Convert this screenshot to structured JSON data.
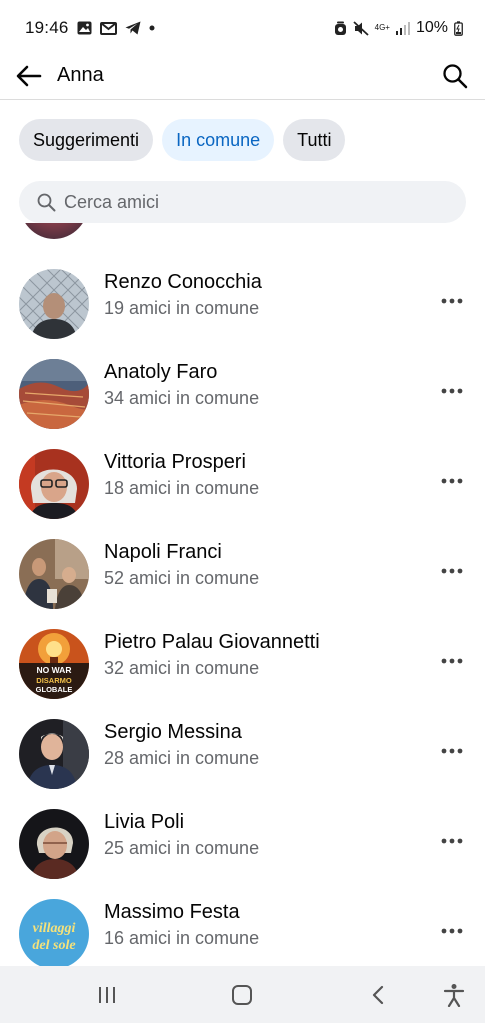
{
  "status_bar": {
    "time": "19:46",
    "network": "4G+",
    "battery": "10%",
    "left_icons": [
      "gallery-icon",
      "gmail-icon",
      "telegram-icon",
      "dot-icon"
    ],
    "right_icons": [
      "alarm-icon",
      "mute-icon",
      "network-icon",
      "signal-icon",
      "battery-icon"
    ]
  },
  "header": {
    "title": "Anna",
    "back_icon": "back-arrow-icon",
    "search_icon": "search-icon"
  },
  "chips": [
    {
      "label": "Suggerimenti",
      "active": false
    },
    {
      "label": "In comune",
      "active": true
    },
    {
      "label": "Tutti",
      "active": false
    }
  ],
  "search": {
    "placeholder": "Cerca amici"
  },
  "friends": [
    {
      "name": "Renzo Conocchia",
      "mutual": "19 amici in comune"
    },
    {
      "name": "Anatoly Faro",
      "mutual": "34 amici in comune"
    },
    {
      "name": "Vittoria Prosperi",
      "mutual": "18 amici in comune"
    },
    {
      "name": "Napoli Franci",
      "mutual": "52 amici in comune"
    },
    {
      "name": "Pietro Palau Giovannetti",
      "mutual": "32 amici in comune",
      "avatar_text": [
        "NO WAR",
        "DISARMO",
        "GLOBALE"
      ]
    },
    {
      "name": "Sergio Messina",
      "mutual": "28 amici in comune"
    },
    {
      "name": "Livia Poli",
      "mutual": "25 amici in comune"
    },
    {
      "name": "Massimo Festa",
      "mutual": "16 amici in comune",
      "avatar_text": [
        "villaggi",
        "del sole"
      ]
    }
  ],
  "nav": {
    "icons": [
      "recent-apps-icon",
      "home-icon",
      "back-icon",
      "accessibility-icon"
    ]
  },
  "colors": {
    "accent": "#0a66c2",
    "active_chip_bg": "#e7f3ff",
    "chip_bg": "#e4e6eb",
    "secondary_text": "#65676b",
    "search_bg": "#f0f2f5"
  }
}
